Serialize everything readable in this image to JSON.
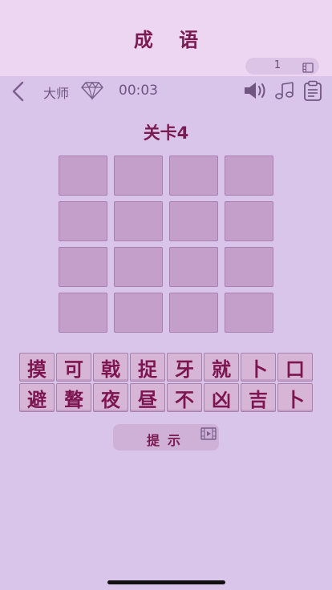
{
  "header": {
    "title": "成 语",
    "coins": "1"
  },
  "toolbar": {
    "level_name": "大师",
    "timer": "00:03"
  },
  "level": {
    "title": "关卡4"
  },
  "board": {
    "rows": 4,
    "cols": 4
  },
  "tiles": {
    "row1": [
      "摸",
      "可",
      "戟",
      "捉",
      "牙",
      "就",
      "卜",
      "口"
    ],
    "row2": [
      "避",
      "聱",
      "夜",
      "昼",
      "不",
      "凶",
      "吉",
      "卜"
    ]
  },
  "hint": {
    "label": "提示"
  },
  "colors": {
    "accent": "#7a1b52",
    "background": "#d9c5e9",
    "header_bg": "#ecd6f1",
    "cell": "#c39fc9",
    "tile": "#d7b5d7"
  },
  "icons": [
    "back-icon",
    "diamond-icon",
    "sound-icon",
    "music-icon",
    "clipboard-icon",
    "video-icon"
  ]
}
